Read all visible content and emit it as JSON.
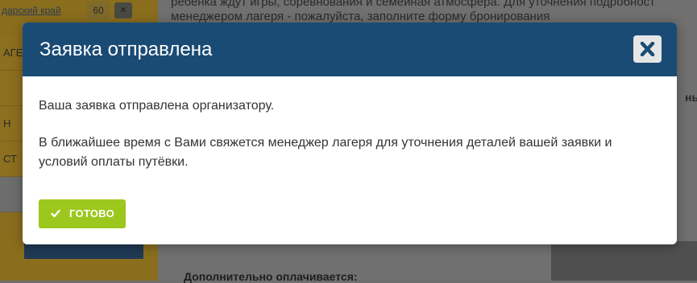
{
  "background": {
    "region_link": "дарский край",
    "region_count": "60",
    "sidebar_rows": [
      "АГЕ",
      "Н",
      "СТ"
    ],
    "text_line1": "ребенка ждут игры, соревнования и семейная атмосфера. Для уточнения подробност",
    "text_line2": "менеджером лагеря - пожалуйста, заполните форму бронирования",
    "cut_text": "ны",
    "bottom_heading": "Дополнительно оплачивается:"
  },
  "modal": {
    "title": "Заявка отправлена",
    "close_icon": "close-x-icon",
    "paragraph1": "Ваша заявка отправлена организатору.",
    "paragraph2": "В ближайшее время с Вами свяжется менеджер лагеря для уточнения деталей вашей заявки и условий оплаты путёвки.",
    "done_label": "ГОТОВО",
    "done_icon": "check-icon"
  },
  "colors": {
    "header": "#1a4b75",
    "done_button": "#9cc81d",
    "overlay": "#6e6e6e"
  }
}
